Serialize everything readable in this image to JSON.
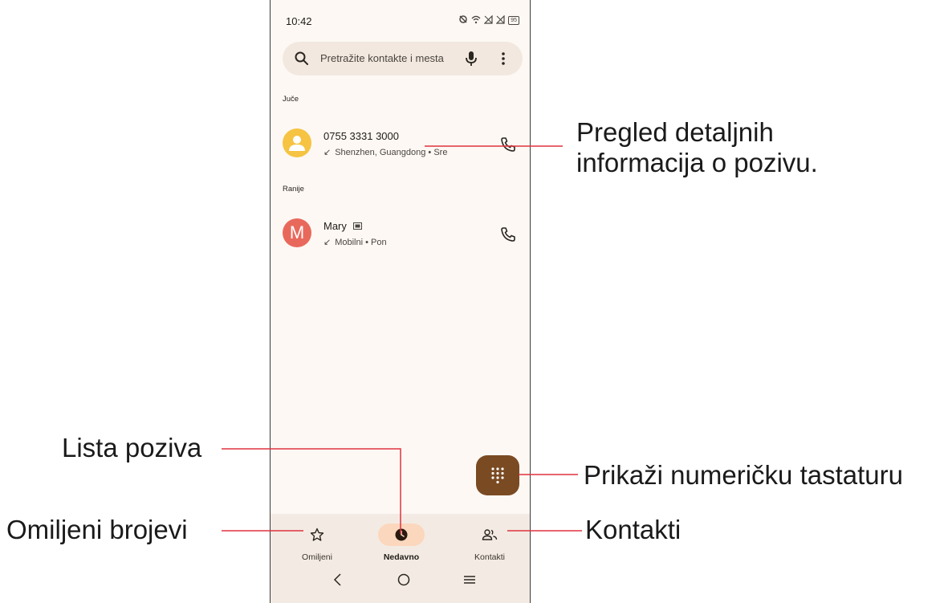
{
  "status_bar": {
    "time": "10:42",
    "battery": "95"
  },
  "search": {
    "placeholder": "Pretražite kontakte i mesta"
  },
  "sections": {
    "yesterday": "Juče",
    "earlier": "Ranije"
  },
  "calls": [
    {
      "name": "0755 3331 3000",
      "detail": "Shenzhen, Guangdong • Sre",
      "avatar_color": "#f6c342"
    },
    {
      "name": "Mary",
      "avatar_letter": "M",
      "detail": "Mobilni • Pon",
      "avatar_color": "#e8695c"
    }
  ],
  "bottom_nav": {
    "favorites": "Omiljeni",
    "recent": "Nedavno",
    "contacts": "Kontakti"
  },
  "callouts": {
    "details": "Pregled detaljnih informacija o pozivu.",
    "details_line1": "Pregled detaljnih",
    "details_line2": "informacija o pozivu.",
    "call_list": "Lista poziva",
    "keypad": "Prikaži numeričku tastaturu",
    "favorites": "Omiljeni brojevi",
    "contacts": "Kontakti"
  },
  "colors": {
    "accent_line": "#e0323f",
    "fab": "#7a4a22",
    "nav_active": "#fbd7bd"
  }
}
